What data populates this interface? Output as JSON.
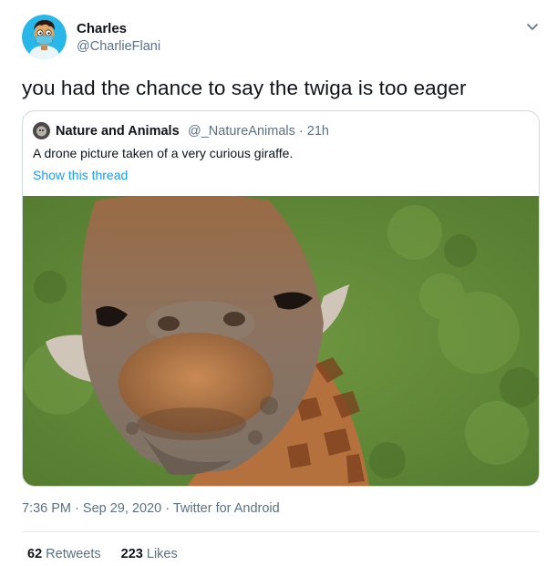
{
  "author": {
    "display_name": "Charles",
    "handle": "@CharlieFlani",
    "avatar_icon": "cartoon-avatar-with-mask"
  },
  "tweet": {
    "text": "you had the chance to say the twiga is too eager",
    "time": "7:36 PM",
    "date": "Sep 29, 2020",
    "separator": "·",
    "source": "Twitter for Android"
  },
  "quoted": {
    "display_name": "Nature and Animals",
    "handle": "@_NatureAnimals",
    "separator": "·",
    "age": "21h",
    "text": "A drone picture taken of a very curious giraffe.",
    "show_thread": "Show this thread",
    "image_description": "giraffe-closeup"
  },
  "stats": {
    "retweets_count": "62",
    "retweets_label": "Retweets",
    "likes_count": "223",
    "likes_label": "Likes"
  },
  "colors": {
    "link": "#1d9bf0",
    "muted": "#5b7083",
    "border": "#cfd9de",
    "text": "#0f1419"
  }
}
